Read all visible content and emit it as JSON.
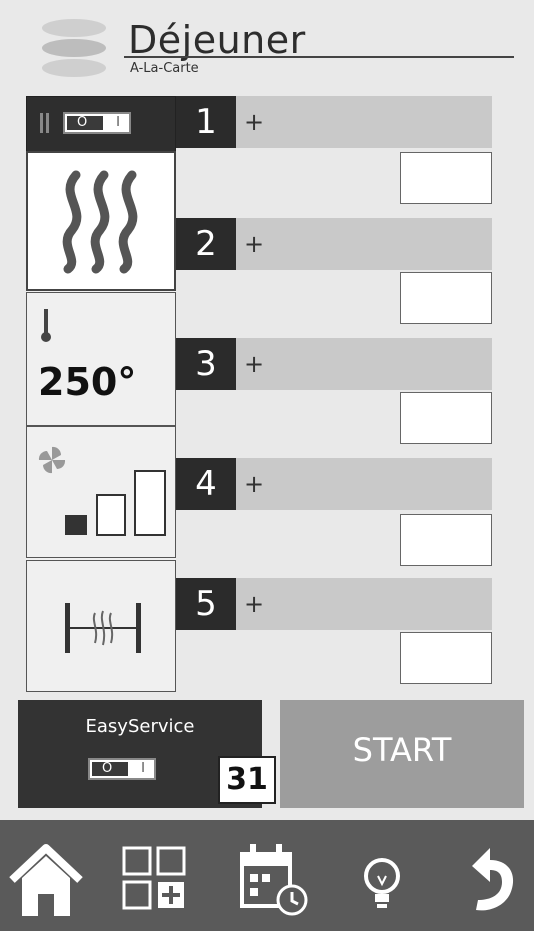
{
  "header": {
    "title": "Déjeuner",
    "subtitle": "A-La-Carte"
  },
  "left_panel": {
    "toggle": {
      "off_label": "O",
      "on_label": "I"
    },
    "temperature": "250°"
  },
  "steps": [
    {
      "number": "1",
      "plus": "+"
    },
    {
      "number": "2",
      "plus": "+"
    },
    {
      "number": "3",
      "plus": "+"
    },
    {
      "number": "4",
      "plus": "+"
    },
    {
      "number": "5",
      "plus": "+"
    }
  ],
  "easy_service": {
    "label": "EasyService",
    "toggle_off_label": "O",
    "toggle_on_label": "I",
    "day": "31"
  },
  "start_button": {
    "label": "START"
  },
  "nav": {
    "icons": [
      "home-icon",
      "grid-add-icon",
      "calendar-clock-icon",
      "lightbulb-icon",
      "back-arrow-icon"
    ]
  },
  "colors": {
    "dark": "#2b2b2b",
    "bar": "#c9c9c9",
    "start": "#9d9d9d",
    "nav": "#5a5a5a"
  }
}
